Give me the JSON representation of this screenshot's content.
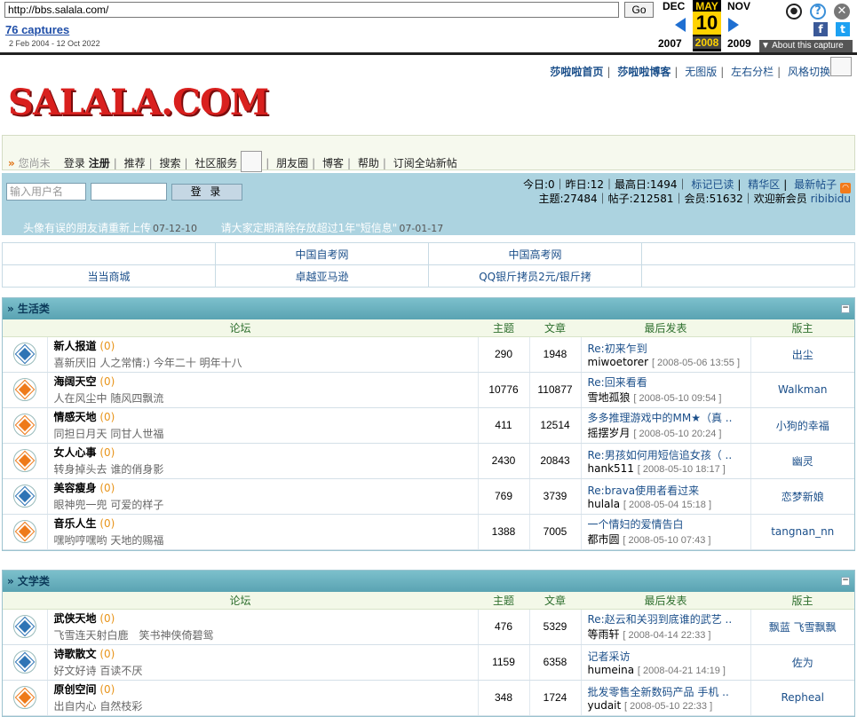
{
  "wayback": {
    "url": "http://bbs.salala.com/",
    "go_label": "Go",
    "captures_label": "76 captures",
    "range": "2 Feb 2004 - 12 Oct 2022",
    "prev_month": "DEC",
    "cur_month": "MAY",
    "next_month": "NOV",
    "cur_day": "10",
    "prev_year": "2007",
    "cur_year": "2008",
    "next_year": "2009",
    "about": "▼ About this capture",
    "user_icon": "user-icon",
    "help_icon": "help-icon",
    "close_icon": "close-icon",
    "fb_icon": "f",
    "tw_icon": "t"
  },
  "toplinks": [
    "莎啦啦首页",
    "莎啦啦博客",
    "无图版",
    "左右分栏",
    "风格切换"
  ],
  "logo": "SALALA.COM",
  "nav": {
    "greeting": "您尚未",
    "items": [
      "登录",
      "注册",
      "推荐",
      "搜索",
      "社区服务",
      "朋友圈",
      "博客",
      "帮助",
      "订阅全站新帖"
    ]
  },
  "login": {
    "user_placeholder": "输入用户名",
    "button": "登 录"
  },
  "stats": {
    "line1_text": "今日:0｜昨日:12｜最高日:1494｜",
    "line1_links": [
      "标记已读",
      "精华区",
      "最新帖子"
    ],
    "line2_text": "主题:27484｜帖子:212581｜会员:51632｜欢迎新会员",
    "new_member": "ribibidu"
  },
  "announcements": [
    {
      "title": "头像有误的朋友请重新上传",
      "date": "07-12-10"
    },
    {
      "title": "请大家定期清除存放超过1年\"短信息\"",
      "date": "07-01-17"
    }
  ],
  "links": [
    [
      "",
      "中国自考网",
      "中国高考网",
      ""
    ],
    [
      "当当商城",
      "卓越亚马逊",
      "QQ银斤拷员2元/银斤拷",
      ""
    ]
  ],
  "headers": {
    "forum": "论坛",
    "topics": "主题",
    "posts": "文章",
    "last": "最后发表",
    "mod": "版主"
  },
  "sections": [
    {
      "title": "» 生活类",
      "forums": [
        {
          "icon": "blue",
          "name": "新人报道",
          "count": "(0)",
          "desc": "喜新厌旧 人之常情:) 今年二十 明年十八",
          "topics": "290",
          "posts": "1948",
          "last_title": "Re:初来乍到",
          "last_user": "miwoetorer",
          "last_date": "[ 2008-05-06 13:55 ]",
          "mod": "出尘"
        },
        {
          "icon": "orange",
          "name": "海阔天空",
          "count": "(0)",
          "desc": "人在风尘中 随风四飘流",
          "topics": "10776",
          "posts": "110877",
          "last_title": "Re:回来看看",
          "last_user": "雪地孤狼",
          "last_date": "[ 2008-05-10 09:54 ]",
          "mod": "Walkman"
        },
        {
          "icon": "orange",
          "name": "情感天地",
          "count": "(0)",
          "desc": "同担日月天 同甘人世福",
          "topics": "411",
          "posts": "12514",
          "last_title": "多多推理游戏中的MM★（真 ..",
          "last_user": "摇摆岁月",
          "last_date": "[ 2008-05-10 20:24 ]",
          "mod": "小狗的幸福"
        },
        {
          "icon": "orange",
          "name": "女人心事",
          "count": "(0)",
          "desc": "转身掉头去 谁的俏身影",
          "topics": "2430",
          "posts": "20843",
          "last_title": "Re:男孩如何用短信追女孩（ ..",
          "last_user": "hank511",
          "last_date": "[ 2008-05-10 18:17 ]",
          "mod": "幽灵"
        },
        {
          "icon": "blue",
          "name": "美容瘦身",
          "count": "(0)",
          "desc": "眼神兜一兜 可爱的样子",
          "topics": "769",
          "posts": "3739",
          "last_title": "Re:brava使用者看过来",
          "last_user": "hulala",
          "last_date": "[ 2008-05-04 15:18 ]",
          "mod": "恋梦新娘"
        },
        {
          "icon": "orange",
          "name": "音乐人生",
          "count": "(0)",
          "desc": "嘿哟哼嘿哟 天地的赐福",
          "topics": "1388",
          "posts": "7005",
          "last_title": "一个情妇的爱情告白",
          "last_user": "都市圆",
          "last_date": "[ 2008-05-10 07:43 ]",
          "mod": "tangnan_nn"
        }
      ]
    },
    {
      "title": "» 文学类",
      "forums": [
        {
          "icon": "blue",
          "name": "武侠天地",
          "count": "(0)",
          "desc": "飞雪连天射白鹿　笑书神侠倚碧鸳",
          "topics": "476",
          "posts": "5329",
          "last_title": "Re:赵云和关羽到底谁的武艺 ..",
          "last_user": "等雨轩",
          "last_date": "[ 2008-04-14 22:33 ]",
          "mod": "飘蓝 飞雪飘飘"
        },
        {
          "icon": "blue",
          "name": "诗歌散文",
          "count": "(0)",
          "desc": "好文好诗 百读不厌",
          "topics": "1159",
          "posts": "6358",
          "last_title": "记者采访",
          "last_user": "humeina",
          "last_date": "[ 2008-04-21 14:19 ]",
          "mod": "佐为"
        },
        {
          "icon": "orange",
          "name": "原创空间",
          "count": "(0)",
          "desc": "出自内心 自然枝彩",
          "topics": "348",
          "posts": "1724",
          "last_title": "批发零售全新数码产品 手机 ..",
          "last_user": "yudait",
          "last_date": "[ 2008-05-10 22:33 ]",
          "mod": "Repheal"
        }
      ]
    }
  ]
}
